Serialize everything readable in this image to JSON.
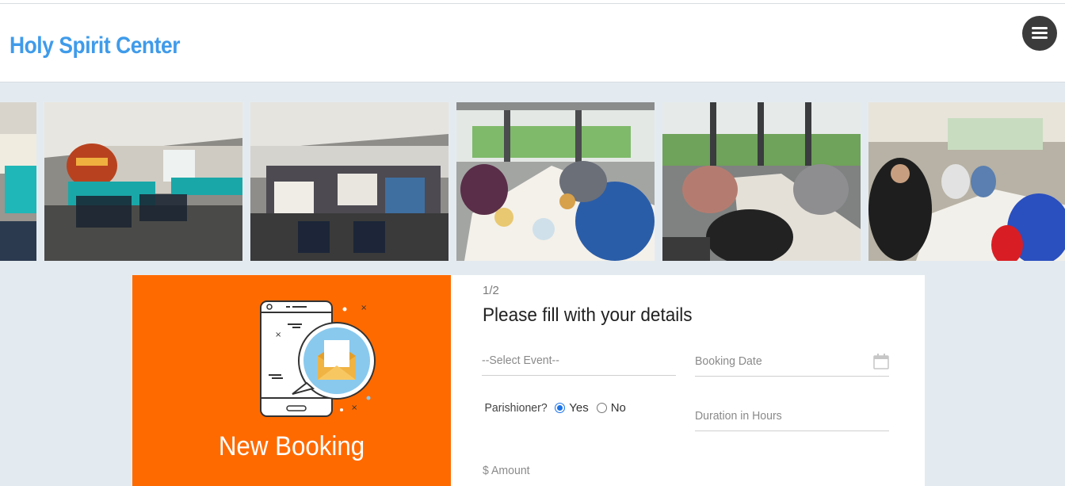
{
  "header": {
    "title": "Holy Spirit Center",
    "menu_icon": "hamburger-icon"
  },
  "gallery": {
    "photos": [
      "banquet-hall-photo",
      "banquet-hall-photo",
      "banquet-hall-photo",
      "dinner-table-photo",
      "dinner-table-photo",
      "family-dinner-photo"
    ]
  },
  "booking": {
    "panel_title": "New Booking",
    "panel_icon": "phone-message-icon",
    "accent_color": "#ff6a00",
    "step": "1/2",
    "form_title": "Please fill with your details",
    "event_select": "--Select Event--",
    "date_placeholder": "Booking Date",
    "calendar_icon": "calendar-icon",
    "parishioner_label": "Parishioner?",
    "yes_label": "Yes",
    "no_label": "No",
    "parishioner_selected": "Yes",
    "duration_placeholder": "Duration in Hours",
    "amount_placeholder": "$ Amount"
  }
}
